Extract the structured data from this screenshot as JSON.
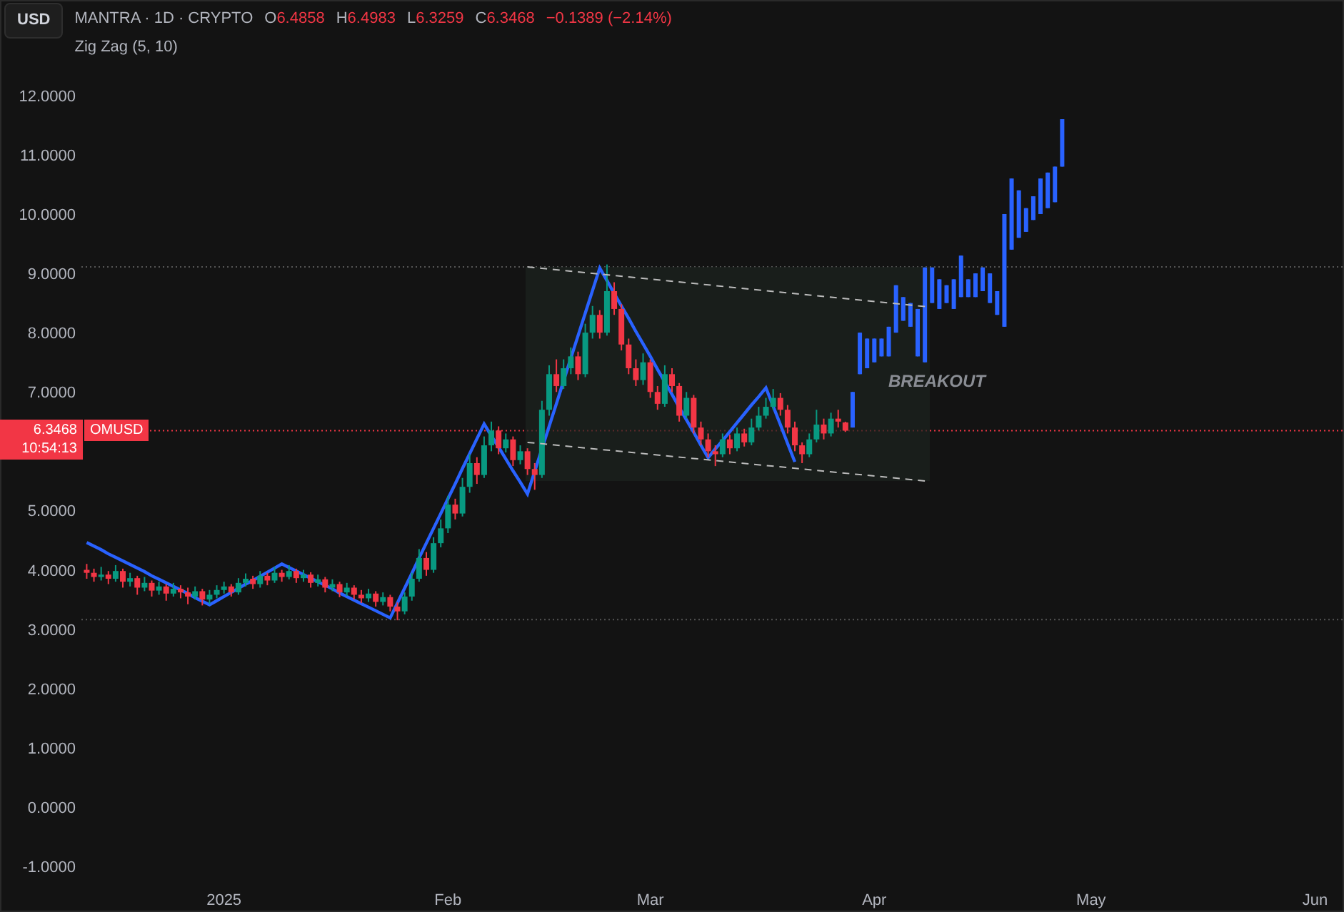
{
  "toolbar": {
    "currency_button": "USD"
  },
  "legend": {
    "symbol": "MANTRA · 1D · CRYPTO",
    "ohlc": [
      {
        "label": "O",
        "value": "6.4858"
      },
      {
        "label": "H",
        "value": "6.4983"
      },
      {
        "label": "L",
        "value": "6.3259"
      },
      {
        "label": "C",
        "value": "6.3468"
      }
    ],
    "change": "−0.1389 (−2.14%)"
  },
  "price_tag": {
    "price": "6.3468",
    "countdown": "10:54:13",
    "symbol": "OMUSD"
  },
  "chart": {
    "chart_data": {
      "type": "candlestick",
      "x": [
        "2024-12-13",
        "2024-12-14",
        "2024-12-15",
        "2024-12-16",
        "2024-12-17",
        "2024-12-18",
        "2024-12-19",
        "2024-12-20",
        "2024-12-21",
        "2024-12-22",
        "2024-12-23",
        "2024-12-24",
        "2024-12-25",
        "2024-12-26",
        "2024-12-27",
        "2024-12-28",
        "2024-12-29",
        "2024-12-30",
        "2024-12-31",
        "2025-01-01",
        "2025-01-02",
        "2025-01-03",
        "2025-01-04",
        "2025-01-05",
        "2025-01-06",
        "2025-01-07",
        "2025-01-08",
        "2025-01-09",
        "2025-01-10",
        "2025-01-11",
        "2025-01-12",
        "2025-01-13",
        "2025-01-14",
        "2025-01-15",
        "2025-01-16",
        "2025-01-17",
        "2025-01-18",
        "2025-01-19",
        "2025-01-20",
        "2025-01-21",
        "2025-01-22",
        "2025-01-23",
        "2025-01-24",
        "2025-01-25",
        "2025-01-26",
        "2025-01-27",
        "2025-01-28",
        "2025-01-29",
        "2025-01-30",
        "2025-01-31",
        "2025-02-01",
        "2025-02-02",
        "2025-02-03",
        "2025-02-04",
        "2025-02-05",
        "2025-02-06",
        "2025-02-07",
        "2025-02-08",
        "2025-02-09",
        "2025-02-10",
        "2025-02-11",
        "2025-02-12",
        "2025-02-13",
        "2025-02-14",
        "2025-02-15",
        "2025-02-16",
        "2025-02-17",
        "2025-02-18",
        "2025-02-19",
        "2025-02-20",
        "2025-02-21",
        "2025-02-22",
        "2025-02-23",
        "2025-02-24",
        "2025-02-25",
        "2025-02-26",
        "2025-02-27",
        "2025-02-28",
        "2025-03-01",
        "2025-03-02",
        "2025-03-03",
        "2025-03-04",
        "2025-03-05",
        "2025-03-06",
        "2025-03-07",
        "2025-03-08",
        "2025-03-09",
        "2025-03-10",
        "2025-03-11",
        "2025-03-12",
        "2025-03-13",
        "2025-03-14",
        "2025-03-15",
        "2025-03-16",
        "2025-03-17",
        "2025-03-18",
        "2025-03-19",
        "2025-03-20",
        "2025-03-21",
        "2025-03-22",
        "2025-03-23",
        "2025-03-24",
        "2025-03-25",
        "2025-03-26",
        "2025-03-27",
        "2025-03-28",
        "2025-03-29",
        "2025-03-30",
        "2025-03-31",
        "2025-04-01",
        "2025-04-02",
        "2025-04-03",
        "2025-04-04",
        "2025-04-05",
        "2025-04-06",
        "2025-04-07",
        "2025-04-08",
        "2025-04-09",
        "2025-04-10",
        "2025-04-11",
        "2025-04-12",
        "2025-04-13",
        "2025-04-14",
        "2025-04-15",
        "2025-04-16",
        "2025-04-17",
        "2025-04-18",
        "2025-04-19",
        "2025-04-20",
        "2025-04-21",
        "2025-04-22",
        "2025-04-23",
        "2025-04-24",
        "2025-04-25",
        "2025-04-26",
        "2025-04-27"
      ],
      "ohlc": [
        [
          4.0,
          4.1,
          3.85,
          3.95
        ],
        [
          3.95,
          4.02,
          3.8,
          3.88
        ],
        [
          3.88,
          4.05,
          3.82,
          3.92
        ],
        [
          3.92,
          3.98,
          3.76,
          3.85
        ],
        [
          3.85,
          4.08,
          3.8,
          3.98
        ],
        [
          3.98,
          4.02,
          3.7,
          3.8
        ],
        [
          3.8,
          3.95,
          3.72,
          3.86
        ],
        [
          3.86,
          3.9,
          3.58,
          3.7
        ],
        [
          3.7,
          3.88,
          3.64,
          3.78
        ],
        [
          3.78,
          3.82,
          3.55,
          3.65
        ],
        [
          3.65,
          3.8,
          3.58,
          3.72
        ],
        [
          3.72,
          3.76,
          3.48,
          3.6
        ],
        [
          3.6,
          3.78,
          3.55,
          3.68
        ],
        [
          3.68,
          3.74,
          3.52,
          3.62
        ],
        [
          3.62,
          3.7,
          3.42,
          3.55
        ],
        [
          3.55,
          3.72,
          3.5,
          3.64
        ],
        [
          3.64,
          3.68,
          3.4,
          3.5
        ],
        [
          3.5,
          3.66,
          3.42,
          3.58
        ],
        [
          3.58,
          3.74,
          3.52,
          3.66
        ],
        [
          3.66,
          3.8,
          3.6,
          3.72
        ],
        [
          3.72,
          3.76,
          3.55,
          3.62
        ],
        [
          3.62,
          3.86,
          3.58,
          3.78
        ],
        [
          3.78,
          3.94,
          3.72,
          3.85
        ],
        [
          3.85,
          3.9,
          3.68,
          3.76
        ],
        [
          3.76,
          3.98,
          3.7,
          3.9
        ],
        [
          3.9,
          3.95,
          3.74,
          3.82
        ],
        [
          3.82,
          4.05,
          3.78,
          3.95
        ],
        [
          3.95,
          4.0,
          3.8,
          3.88
        ],
        [
          3.88,
          4.08,
          3.84,
          3.98
        ],
        [
          3.98,
          4.02,
          3.78,
          3.86
        ],
        [
          3.86,
          4.0,
          3.8,
          3.92
        ],
        [
          3.92,
          3.96,
          3.7,
          3.78
        ],
        [
          3.78,
          3.92,
          3.72,
          3.84
        ],
        [
          3.84,
          3.88,
          3.62,
          3.7
        ],
        [
          3.7,
          3.84,
          3.64,
          3.76
        ],
        [
          3.76,
          3.8,
          3.54,
          3.62
        ],
        [
          3.62,
          3.78,
          3.56,
          3.7
        ],
        [
          3.7,
          3.74,
          3.5,
          3.58
        ],
        [
          3.58,
          3.66,
          3.44,
          3.52
        ],
        [
          3.52,
          3.68,
          3.46,
          3.6
        ],
        [
          3.6,
          3.64,
          3.38,
          3.46
        ],
        [
          3.46,
          3.62,
          3.4,
          3.54
        ],
        [
          3.54,
          3.58,
          3.3,
          3.38
        ],
        [
          3.38,
          3.45,
          3.15,
          3.3
        ],
        [
          3.3,
          3.62,
          3.25,
          3.55
        ],
        [
          3.55,
          3.95,
          3.48,
          3.85
        ],
        [
          3.85,
          4.35,
          3.8,
          4.2
        ],
        [
          4.2,
          4.3,
          3.9,
          4.0
        ],
        [
          4.0,
          4.55,
          3.95,
          4.45
        ],
        [
          4.45,
          4.85,
          4.38,
          4.7
        ],
        [
          4.7,
          5.25,
          4.62,
          5.1
        ],
        [
          5.1,
          5.2,
          4.85,
          4.95
        ],
        [
          4.95,
          5.55,
          4.9,
          5.4
        ],
        [
          5.4,
          5.95,
          5.3,
          5.8
        ],
        [
          5.8,
          5.9,
          5.45,
          5.6
        ],
        [
          5.6,
          6.25,
          5.55,
          6.1
        ],
        [
          6.1,
          6.5,
          6.0,
          6.35
        ],
        [
          6.35,
          6.42,
          5.95,
          6.05
        ],
        [
          6.05,
          6.3,
          5.98,
          6.2
        ],
        [
          6.2,
          6.25,
          5.75,
          5.85
        ],
        [
          5.85,
          6.1,
          5.78,
          6.0
        ],
        [
          6.0,
          6.05,
          5.6,
          5.7
        ],
        [
          5.7,
          5.8,
          5.35,
          5.6
        ],
        [
          5.6,
          6.85,
          5.55,
          6.7
        ],
        [
          6.7,
          7.45,
          6.6,
          7.3
        ],
        [
          7.3,
          7.55,
          7.0,
          7.1
        ],
        [
          7.1,
          7.55,
          7.05,
          7.4
        ],
        [
          7.4,
          7.75,
          7.3,
          7.6
        ],
        [
          7.6,
          7.68,
          7.2,
          7.3
        ],
        [
          7.3,
          8.15,
          7.25,
          8.0
        ],
        [
          8.0,
          8.45,
          7.9,
          8.3
        ],
        [
          8.3,
          8.38,
          7.9,
          8.0
        ],
        [
          8.0,
          9.15,
          7.95,
          8.7
        ],
        [
          8.7,
          8.85,
          8.3,
          8.4
        ],
        [
          8.4,
          8.48,
          7.7,
          7.8
        ],
        [
          7.8,
          7.9,
          7.3,
          7.4
        ],
        [
          7.4,
          7.55,
          7.1,
          7.2
        ],
        [
          7.2,
          7.65,
          7.12,
          7.5
        ],
        [
          7.5,
          7.55,
          6.9,
          7.0
        ],
        [
          7.0,
          7.1,
          6.7,
          6.8
        ],
        [
          6.8,
          7.45,
          6.75,
          7.3
        ],
        [
          7.3,
          7.4,
          7.0,
          7.1
        ],
        [
          7.1,
          7.15,
          6.5,
          6.6
        ],
        [
          6.6,
          7.0,
          6.55,
          6.9
        ],
        [
          6.9,
          6.95,
          6.3,
          6.4
        ],
        [
          6.4,
          6.5,
          6.1,
          6.2
        ],
        [
          6.2,
          6.3,
          5.9,
          6.0
        ],
        [
          6.0,
          6.1,
          5.75,
          5.95
        ],
        [
          5.95,
          6.3,
          5.9,
          6.2
        ],
        [
          6.2,
          6.28,
          5.95,
          6.05
        ],
        [
          6.05,
          6.4,
          6.0,
          6.3
        ],
        [
          6.3,
          6.38,
          6.08,
          6.15
        ],
        [
          6.15,
          6.55,
          6.1,
          6.4
        ],
        [
          6.4,
          6.75,
          6.35,
          6.6
        ],
        [
          6.6,
          6.9,
          6.55,
          6.75
        ],
        [
          6.75,
          7.05,
          6.7,
          6.9
        ],
        [
          6.9,
          6.98,
          6.6,
          6.7
        ],
        [
          6.7,
          6.78,
          6.3,
          6.4
        ],
        [
          6.4,
          6.5,
          6.0,
          6.1
        ],
        [
          6.1,
          6.15,
          5.8,
          5.95
        ],
        [
          5.95,
          6.3,
          5.9,
          6.2
        ],
        [
          6.2,
          6.7,
          6.15,
          6.45
        ],
        [
          6.45,
          6.55,
          6.2,
          6.3
        ],
        [
          6.3,
          6.65,
          6.25,
          6.55
        ],
        [
          6.55,
          6.7,
          6.4,
          6.5
        ],
        [
          6.4858,
          6.4983,
          6.3259,
          6.3468
        ],
        [
          6.4,
          7.0,
          6.4,
          7.0
        ],
        [
          7.3,
          8.0,
          7.3,
          8.0
        ],
        [
          7.4,
          7.9,
          7.4,
          7.9
        ],
        [
          7.5,
          7.9,
          7.5,
          7.9
        ],
        [
          7.6,
          7.9,
          7.6,
          7.9
        ],
        [
          7.6,
          8.1,
          7.6,
          8.1
        ],
        [
          8.0,
          8.8,
          8.0,
          8.8
        ],
        [
          8.2,
          8.6,
          8.2,
          8.6
        ],
        [
          8.1,
          8.5,
          8.1,
          8.5
        ],
        [
          7.6,
          8.4,
          7.6,
          8.4
        ],
        [
          7.5,
          9.1,
          7.5,
          9.1
        ],
        [
          8.5,
          9.1,
          8.5,
          9.1
        ],
        [
          8.4,
          8.9,
          8.4,
          8.9
        ],
        [
          8.5,
          8.8,
          8.5,
          8.8
        ],
        [
          8.4,
          8.9,
          8.4,
          8.9
        ],
        [
          8.6,
          9.3,
          8.6,
          9.3
        ],
        [
          8.6,
          8.9,
          8.6,
          8.9
        ],
        [
          8.6,
          9.0,
          8.6,
          9.0
        ],
        [
          8.7,
          9.1,
          8.7,
          9.1
        ],
        [
          8.5,
          9.0,
          8.5,
          9.0
        ],
        [
          8.3,
          8.7,
          8.3,
          8.7
        ],
        [
          8.1,
          10.0,
          8.1,
          10.0
        ],
        [
          9.4,
          10.6,
          9.4,
          10.6
        ],
        [
          9.6,
          10.4,
          9.6,
          10.4
        ],
        [
          9.7,
          10.1,
          9.7,
          10.1
        ],
        [
          9.9,
          10.3,
          9.9,
          10.3
        ],
        [
          10.0,
          10.6,
          10.0,
          10.6
        ],
        [
          10.1,
          10.7,
          10.1,
          10.7
        ],
        [
          10.2,
          10.8,
          10.2,
          10.8
        ],
        [
          10.8,
          11.6,
          10.8,
          11.6
        ]
      ],
      "colors": [
        null,
        null,
        null,
        null,
        null,
        null,
        null,
        null,
        null,
        null,
        null,
        null,
        null,
        null,
        null,
        null,
        null,
        null,
        null,
        null,
        null,
        null,
        null,
        null,
        null,
        null,
        null,
        null,
        null,
        null,
        null,
        null,
        null,
        null,
        null,
        null,
        null,
        null,
        null,
        null,
        null,
        null,
        null,
        null,
        null,
        null,
        null,
        null,
        null,
        null,
        null,
        null,
        null,
        null,
        null,
        null,
        null,
        null,
        null,
        null,
        null,
        null,
        null,
        null,
        null,
        null,
        null,
        null,
        null,
        null,
        null,
        null,
        null,
        null,
        null,
        null,
        null,
        null,
        null,
        null,
        null,
        null,
        null,
        null,
        null,
        null,
        null,
        null,
        null,
        null,
        null,
        null,
        null,
        null,
        null,
        null,
        null,
        null,
        null,
        null,
        null,
        null,
        null,
        null,
        null,
        null,
        "#2962ff",
        "#2962ff",
        "#2962ff",
        "#2962ff",
        "#2962ff",
        "#2962ff",
        "#2962ff",
        "#2962ff",
        "#2962ff",
        "#2962ff",
        "#2962ff",
        "#2962ff",
        "#2962ff",
        "#2962ff",
        "#2962ff",
        "#2962ff",
        "#2962ff",
        "#2962ff",
        "#2962ff",
        "#2962ff",
        "#2962ff",
        "#2962ff",
        "#2962ff",
        "#2962ff",
        "#2962ff",
        "#2962ff",
        "#2962ff",
        "#2962ff",
        "#2962ff",
        "#2962ff"
      ],
      "series": [
        {
          "name": "Zig Zag (5, 10)",
          "type": "line",
          "color": "#2962ff",
          "values": [
            4.46,
            4.4,
            4.34,
            4.27,
            4.21,
            4.15,
            4.09,
            4.03,
            3.97,
            3.9,
            3.84,
            3.78,
            3.72,
            3.66,
            3.6,
            3.53,
            3.47,
            3.41,
            3.48,
            3.55,
            3.62,
            3.69,
            3.76,
            3.82,
            3.89,
            3.96,
            4.03,
            4.1,
            4.04,
            3.98,
            3.92,
            3.86,
            3.8,
            3.74,
            3.68,
            3.61,
            3.55,
            3.49,
            3.43,
            3.37,
            3.31,
            3.25,
            3.19,
            3.44,
            3.69,
            3.94,
            4.2,
            4.45,
            4.7,
            4.95,
            5.2,
            5.45,
            5.71,
            5.96,
            6.21,
            6.46,
            6.26,
            6.07,
            5.87,
            5.67,
            5.48,
            5.28,
            5.66,
            6.04,
            6.42,
            6.8,
            7.19,
            7.57,
            7.95,
            8.33,
            8.71,
            9.09,
            8.88,
            8.66,
            8.45,
            8.24,
            8.02,
            7.81,
            7.6,
            7.38,
            7.17,
            6.96,
            6.74,
            6.53,
            6.32,
            6.1,
            5.89,
            6.04,
            6.18,
            6.33,
            6.48,
            6.63,
            6.78,
            6.92,
            7.07,
            6.76,
            6.45,
            6.13,
            5.82,
            null,
            null,
            null,
            null,
            null,
            null,
            null,
            null,
            null,
            null,
            null,
            null,
            null,
            null,
            null,
            null,
            null,
            null,
            null,
            null,
            null,
            null,
            null,
            null,
            null,
            null,
            null,
            null,
            null,
            null,
            null,
            null,
            null,
            null,
            null,
            null,
            null
          ]
        },
        {
          "type": "line",
          "color": "#bbbbbb",
          "line_style": "dashed",
          "values": [
            null,
            null,
            null,
            null,
            null,
            null,
            null,
            null,
            null,
            null,
            null,
            null,
            null,
            null,
            null,
            null,
            null,
            null,
            null,
            null,
            null,
            null,
            null,
            null,
            null,
            null,
            null,
            null,
            null,
            null,
            null,
            null,
            null,
            null,
            null,
            null,
            null,
            null,
            null,
            null,
            null,
            null,
            null,
            null,
            null,
            null,
            null,
            null,
            null,
            null,
            null,
            null,
            null,
            null,
            null,
            null,
            null,
            null,
            null,
            null,
            null,
            9.11,
            null,
            null,
            null,
            null,
            null,
            null,
            null,
            null,
            null,
            null,
            null,
            null,
            null,
            null,
            null,
            null,
            null,
            null,
            null,
            null,
            null,
            null,
            null,
            null,
            null,
            null,
            null,
            null,
            null,
            null,
            null,
            null,
            null,
            null,
            null,
            null,
            null,
            null,
            null,
            null,
            null,
            null,
            null,
            null,
            null,
            null,
            null,
            null,
            null,
            null,
            null,
            null,
            null,
            null,
            8.44,
            null,
            null,
            null,
            null,
            null,
            null,
            null,
            null,
            null,
            null,
            null,
            null,
            null,
            null,
            null,
            null,
            null,
            null,
            null
          ]
        },
        {
          "type": "line",
          "color": "#bbbbbb",
          "line_style": "dashed",
          "values": [
            null,
            null,
            null,
            null,
            null,
            null,
            null,
            null,
            null,
            null,
            null,
            null,
            null,
            null,
            null,
            null,
            null,
            null,
            null,
            null,
            null,
            null,
            null,
            null,
            null,
            null,
            null,
            null,
            null,
            null,
            null,
            null,
            null,
            null,
            null,
            null,
            null,
            null,
            null,
            null,
            null,
            null,
            null,
            null,
            null,
            null,
            null,
            null,
            null,
            null,
            null,
            null,
            null,
            null,
            null,
            null,
            null,
            null,
            null,
            null,
            null,
            6.15,
            null,
            null,
            null,
            null,
            null,
            null,
            null,
            null,
            null,
            null,
            null,
            null,
            null,
            null,
            null,
            null,
            null,
            null,
            null,
            null,
            null,
            null,
            null,
            null,
            null,
            null,
            null,
            null,
            null,
            null,
            null,
            null,
            null,
            null,
            null,
            null,
            null,
            null,
            null,
            null,
            null,
            null,
            null,
            null,
            null,
            null,
            null,
            null,
            null,
            null,
            null,
            null,
            null,
            null,
            5.5,
            null,
            null,
            null,
            null,
            null,
            null,
            null,
            null,
            null,
            null,
            null,
            null,
            null,
            null,
            null,
            null,
            null,
            null,
            null
          ]
        }
      ],
      "ref_lines": [
        {
          "axis": "y",
          "value": 9.11,
          "color": "#555555"
        },
        {
          "axis": "y",
          "value": 6.3468,
          "color": "#f23645"
        },
        {
          "axis": "y",
          "value": 3.16,
          "color": "#555555"
        }
      ],
      "xlim": [
        "2024-12-01",
        "2025-06-05"
      ],
      "ylim": [
        -1.77,
        13.61
      ],
      "yticks": [
        {
          "value": -1,
          "label": "-1.0000"
        },
        {
          "value": 0,
          "label": "0.0000"
        },
        {
          "value": 1,
          "label": "1.0000"
        },
        {
          "value": 2,
          "label": "2.0000"
        },
        {
          "value": 3,
          "label": "3.0000"
        },
        {
          "value": 4,
          "label": "4.0000"
        },
        {
          "value": 5,
          "label": "5.0000"
        },
        {
          "value": 7,
          "label": "7.0000"
        },
        {
          "value": 8,
          "label": "8.0000"
        },
        {
          "value": 9,
          "label": "9.0000"
        },
        {
          "value": 10,
          "label": "10.0000"
        },
        {
          "value": 11,
          "label": "11.0000"
        },
        {
          "value": 12,
          "label": "12.0000"
        }
      ],
      "xticks": [
        {
          "value": "2025-01-01",
          "label": "2025"
        },
        {
          "value": "2025-02-01",
          "label": "Feb"
        },
        {
          "value": "2025-03-01",
          "label": "Mar"
        },
        {
          "value": "2025-04-01",
          "label": "Apr"
        },
        {
          "value": "2025-05-01",
          "label": "May"
        },
        {
          "value": "2025-06-01",
          "label": "Jun"
        }
      ],
      "annotations": [
        "BREAKOUT"
      ]
    }
  }
}
